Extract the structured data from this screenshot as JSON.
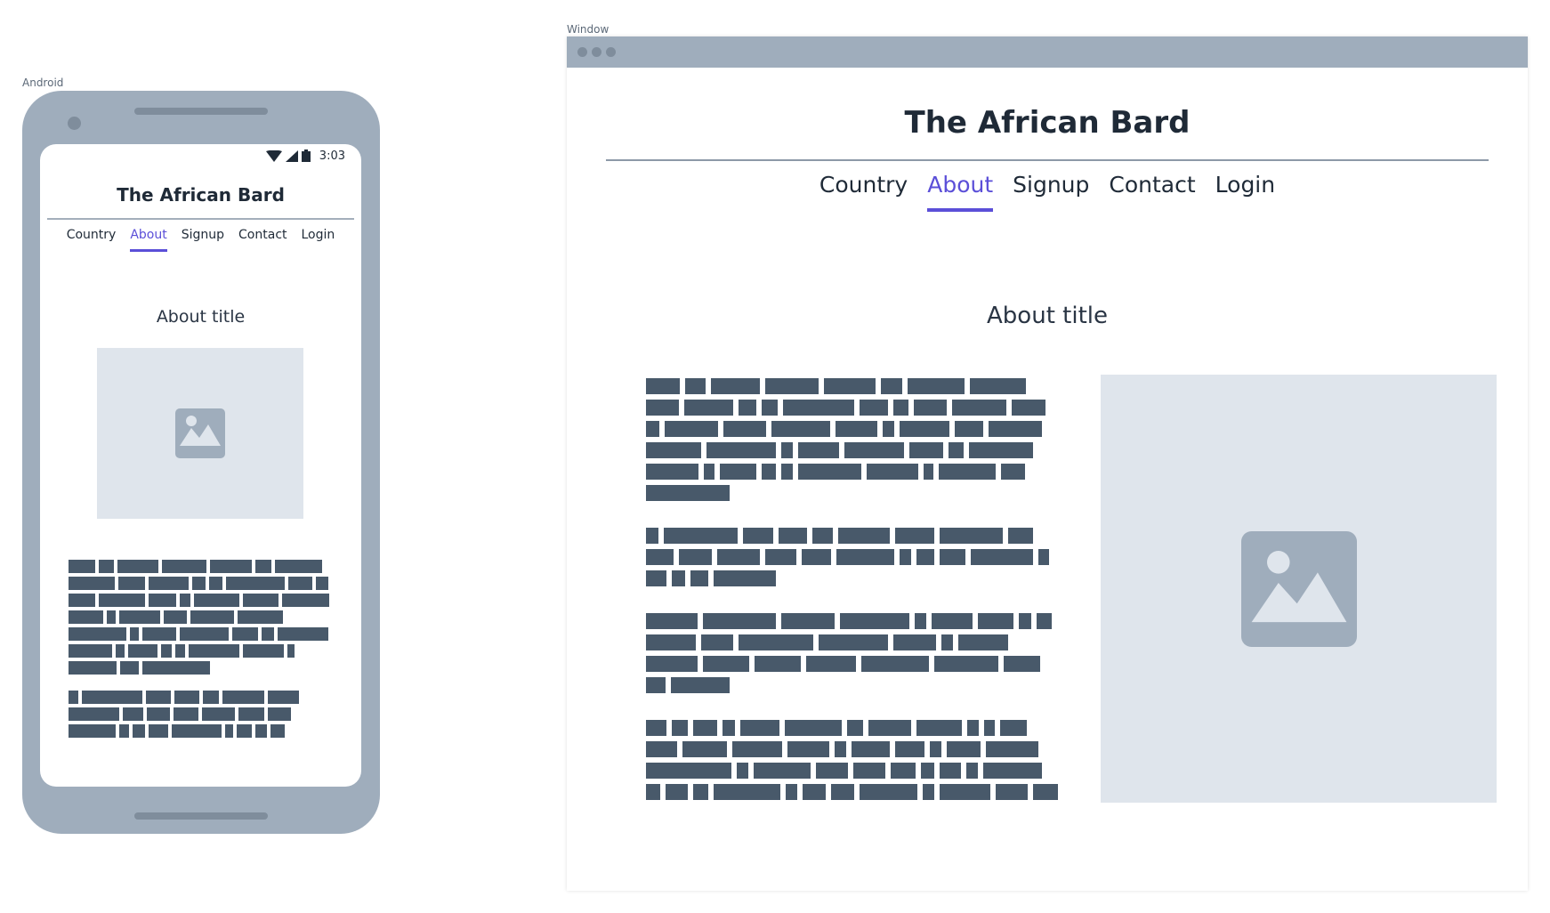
{
  "labels": {
    "android": "Android",
    "window": "Window"
  },
  "site": {
    "title": "The African Bard",
    "nav": [
      "Country",
      "About",
      "Signup",
      "Contact",
      "Login"
    ],
    "active_nav": "About",
    "about_title": "About title"
  },
  "status_bar": {
    "time": "3:03"
  },
  "icons": {
    "wifi": "wifi-icon",
    "cellular": "cellular-signal-icon",
    "battery": "battery-icon",
    "image_placeholder": "image-placeholder-icon",
    "window_controls": "window-control-dots"
  },
  "colors": {
    "accent": "#5b4fd8",
    "device": "#9fadbc",
    "placeholder_text_block": "#48596a",
    "image_placeholder_bg": "#dfe5ec",
    "heading_text": "#1f2a37"
  }
}
